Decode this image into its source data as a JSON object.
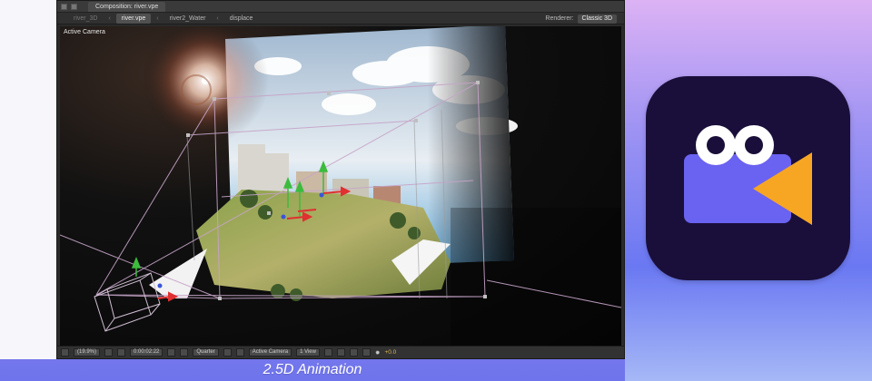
{
  "window": {
    "composition_tab": "Composition: river.vpe",
    "tabs": [
      {
        "label": "river_3D",
        "state": "dim"
      },
      {
        "label": "river.vpe",
        "state": "active"
      },
      {
        "label": "river2_Water",
        "state": "normal"
      },
      {
        "label": "displace",
        "state": "normal"
      }
    ],
    "renderer_label": "Renderer:",
    "renderer_value": "Classic 3D"
  },
  "viewport": {
    "camera_label": "Active Camera"
  },
  "statusbar": {
    "zoom": "(19.9%)",
    "timecode": "0:00:02:22",
    "resolution": "Quarter",
    "camera_view": "Active Camera",
    "view_layout": "1 View",
    "exposure": "+0.0"
  },
  "caption": "2.5D Animation",
  "colors": {
    "caption_bg": "#b9aef5",
    "icon_bg": "#1a0f3a",
    "camera_body": "#6a62f0",
    "camera_lens": "#f6a623",
    "eye_white": "#ffffff",
    "pupil": "#1a0f3a"
  },
  "icons": {
    "app_icon": "video-camera-eyes-icon",
    "camera_gizmo": "camera-wireframe-icon"
  }
}
